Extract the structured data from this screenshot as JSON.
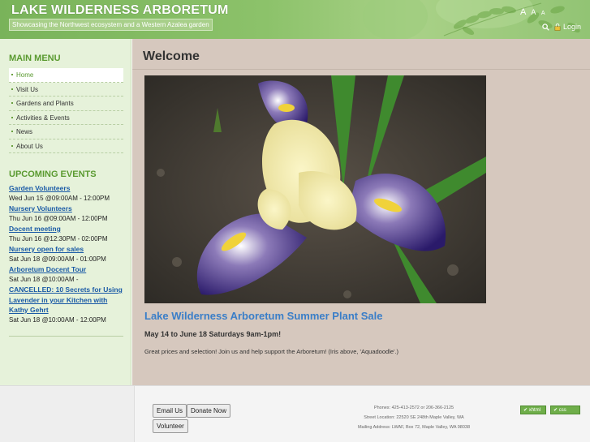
{
  "header": {
    "site_title": "LAKE WILDERNESS ARBORETUM",
    "tagline": "Showcasing the Northwest ecosystem and a Western Azalea garden",
    "font_controls": [
      "A",
      "A",
      "A"
    ],
    "login_label": "Login",
    "colors": {
      "banner": "#8cc26a",
      "title": "#ffffff"
    }
  },
  "sidebar": {
    "menu_heading": "MAIN MENU",
    "menu_items": [
      {
        "label": "Home",
        "active": true
      },
      {
        "label": "Visit Us"
      },
      {
        "label": "Gardens and Plants"
      },
      {
        "label": "Activities & Events"
      },
      {
        "label": "News"
      },
      {
        "label": "About Us"
      }
    ],
    "events_heading": "UPCOMING EVENTS",
    "events": [
      {
        "title": "Garden Volunteers",
        "time": "Wed Jun 15 @09:00AM - 12:00PM"
      },
      {
        "title": "Nursery Volunteers",
        "time": "Thu Jun 16 @09:00AM - 12:00PM"
      },
      {
        "title": "Docent meeting",
        "time": "Thu Jun 16 @12:30PM - 02:00PM"
      },
      {
        "title": "Nursery open for sales",
        "time": "Sat Jun 18 @09:00AM - 01:00PM"
      },
      {
        "title": "Arboretum Docent Tour",
        "time": "Sat Jun 18 @10:00AM -"
      },
      {
        "title": "CANCELLED: 10 Secrets for Using Lavender in your Kitchen with Kathy Gehrt",
        "time": "Sat Jun 18 @10:00AM - 12:00PM"
      }
    ]
  },
  "main": {
    "page_title": "Welcome",
    "hero_icon": "iris-flower-photo",
    "article_title": "Lake Wilderness Arboretum Summer Plant Sale",
    "article_dates": "May 14 to June 18 Saturdays 9am-1pm!",
    "article_body": "Great prices and selection! Join us and help support the Arboretum! (Iris above, 'Aquadoodle'.)"
  },
  "footer": {
    "buttons": {
      "email": "Email Us",
      "donate": "Donate Now",
      "volunteer": "Volunteer"
    },
    "contact_lines": [
      "Phones: 425-413-2572 or 206-366-2125",
      "Street Location: 22520 SE 248th Maple Valley, WA",
      "Mailing Address: LWAF, Box 72, Maple Valley, WA 98038"
    ],
    "badges": {
      "xhtml": "xhtml",
      "css": "css"
    }
  }
}
